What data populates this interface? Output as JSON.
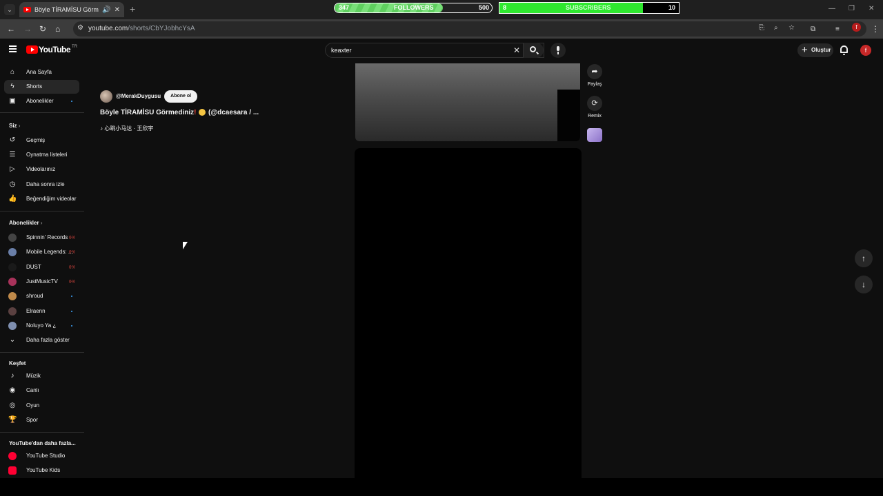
{
  "browser": {
    "tab_title": "Böyle TİRAMİSU Görmedin",
    "url_host": "youtube.com",
    "url_path": "/shorts/CbYJobhcYsA",
    "profile_initial": "f"
  },
  "overlay": {
    "followers": {
      "current": "347",
      "label": "FOLLOWERS",
      "goal": "500",
      "progress": 0.69
    },
    "subscribers": {
      "current": "8",
      "label": "SUBSCRIBERS",
      "goal": "10",
      "progress": 0.8
    }
  },
  "youtube": {
    "logo_text": "YouTube",
    "logo_region": "TR",
    "search_value": "keaxter",
    "create_label": "Oluştur",
    "avatar_initial": "f"
  },
  "sidebar": {
    "main": [
      {
        "label": "Ana Sayfa",
        "icon": "home-icon"
      },
      {
        "label": "Shorts",
        "icon": "shorts-icon"
      },
      {
        "label": "Abonelikler",
        "icon": "subscriptions-icon"
      }
    ],
    "you_section": "Siz",
    "you_items": [
      {
        "label": "Geçmiş",
        "icon": "history-icon"
      },
      {
        "label": "Oynatma listeleri",
        "icon": "playlists-icon"
      },
      {
        "label": "Videolarınız",
        "icon": "your-videos-icon"
      },
      {
        "label": "Daha sonra izle",
        "icon": "watch-later-icon"
      },
      {
        "label": "Beğendiğim videolar",
        "icon": "liked-icon"
      }
    ],
    "subs_section": "Abonelikler",
    "subs": [
      {
        "label": "Spinnin' Records",
        "live": true,
        "color": "#444444"
      },
      {
        "label": "Mobile Legends: ...",
        "live": true,
        "color": "#6a7fa8"
      },
      {
        "label": "DUST",
        "live": true,
        "color": "#1a1a1a"
      },
      {
        "label": "JustMusicTV",
        "live": true,
        "color": "#a8325a"
      },
      {
        "label": "shroud",
        "live": false,
        "color": "#c08a4a"
      },
      {
        "label": "Elraenn",
        "live": false,
        "color": "#5a4040"
      },
      {
        "label": "Noluyo Ya ¿",
        "live": false,
        "color": "#7f8fb0"
      }
    ],
    "show_more": "Daha fazla göster",
    "explore_section": "Keşfet",
    "explore": [
      {
        "label": "Müzik",
        "icon": "music-icon"
      },
      {
        "label": "Canlı",
        "icon": "live-icon"
      },
      {
        "label": "Oyun",
        "icon": "gaming-icon"
      },
      {
        "label": "Spor",
        "icon": "trophy-icon"
      }
    ],
    "more_section": "YouTube'dan daha fazla...",
    "more": [
      {
        "label": "YouTube Studio"
      },
      {
        "label": "YouTube Kids"
      }
    ]
  },
  "video": {
    "channel": "@MerakDuygusu",
    "subscribe_label": "Abone ol",
    "title_part1": "Böyle TİRAMİSU Görmediniz",
    "title_part2": "(@dcaesara / ...",
    "music": "♪ 心跳小马达 · 王欣宇"
  },
  "actions": {
    "share": "Paylaş",
    "remix": "Remix"
  }
}
